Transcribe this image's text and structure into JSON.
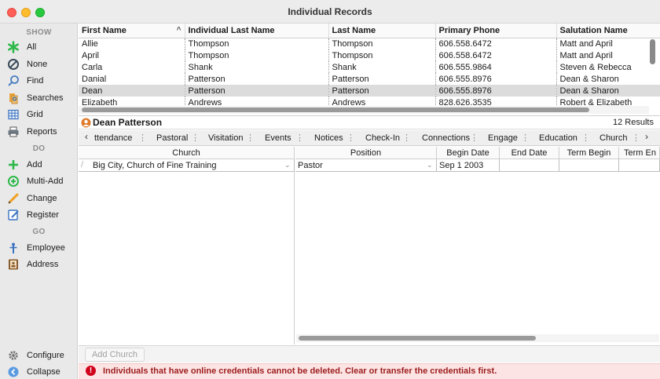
{
  "window": {
    "title": "Individual Records"
  },
  "sidebar": {
    "sections": {
      "show": "SHOW",
      "do": "DO",
      "go": "GO"
    },
    "show_items": [
      {
        "label": "All",
        "icon": "asterisk-icon"
      },
      {
        "label": "None",
        "icon": "prohibited-icon"
      },
      {
        "label": "Find",
        "icon": "magnifier-icon"
      },
      {
        "label": "Searches",
        "icon": "saved-search-icon"
      },
      {
        "label": "Grid",
        "icon": "grid-icon"
      },
      {
        "label": "Reports",
        "icon": "printer-icon"
      }
    ],
    "do_items": [
      {
        "label": "Add",
        "icon": "plus-icon"
      },
      {
        "label": "Multi-Add",
        "icon": "multi-add-icon"
      },
      {
        "label": "Change",
        "icon": "pencil-icon"
      },
      {
        "label": "Register",
        "icon": "register-icon"
      }
    ],
    "go_items": [
      {
        "label": "Employee",
        "icon": "employee-icon"
      },
      {
        "label": "Address",
        "icon": "address-book-icon"
      }
    ],
    "footer_items": [
      {
        "label": "Configure",
        "icon": "gear-icon"
      },
      {
        "label": "Collapse",
        "icon": "collapse-icon"
      }
    ]
  },
  "list": {
    "columns": [
      "First Name",
      "Individual Last Name",
      "Last Name",
      "Primary Phone",
      "Salutation Name"
    ],
    "sort_indicator": "^",
    "rows": [
      [
        "Allie",
        "Thompson",
        "Thompson",
        "606.558.6472",
        "Matt and April"
      ],
      [
        "April",
        "Thompson",
        "Thompson",
        "606.558.6472",
        "Matt and April"
      ],
      [
        "Carla",
        "Shank",
        "Shank",
        "606.555.9864",
        "Steven & Rebecca"
      ],
      [
        "Danial",
        "Patterson",
        "Patterson",
        "606.555.8976",
        "Dean & Sharon"
      ],
      [
        "Dean",
        "Patterson",
        "Patterson",
        "606.555.8976",
        "Dean & Sharon"
      ],
      [
        "Elizabeth",
        "Andrews",
        "Andrews",
        "828.626.3535",
        "Robert & Elizabeth"
      ]
    ],
    "selected_row": 4
  },
  "record": {
    "name": "Dean Patterson",
    "count": "12 Results"
  },
  "tabs": [
    "ttendance",
    "Pastoral",
    "Visitation",
    "Events",
    "Notices",
    "Check-In",
    "Connections",
    "Engage",
    "Education",
    "Church"
  ],
  "detail": {
    "church_column": "Church",
    "position_columns": [
      "Position",
      "Begin Date",
      "End Date",
      "Term Begin",
      "Term En"
    ],
    "row": {
      "church": "Big City, Church of Fine Training",
      "position": "Pastor",
      "begin_date": "Sep 1 2003",
      "end_date": "",
      "term_begin": "",
      "term_end": ""
    }
  },
  "bottom": {
    "add_church_label": "Add Church"
  },
  "alert": {
    "icon": "!",
    "message": "Individuals that have online credentials cannot be deleted. Clear or transfer the credentials first."
  },
  "colors": {
    "alert_bg": "#fde4e4",
    "alert_text": "#9b1c1c",
    "alert_icon": "#d0021b",
    "selected_row": "#dcdcdc"
  }
}
